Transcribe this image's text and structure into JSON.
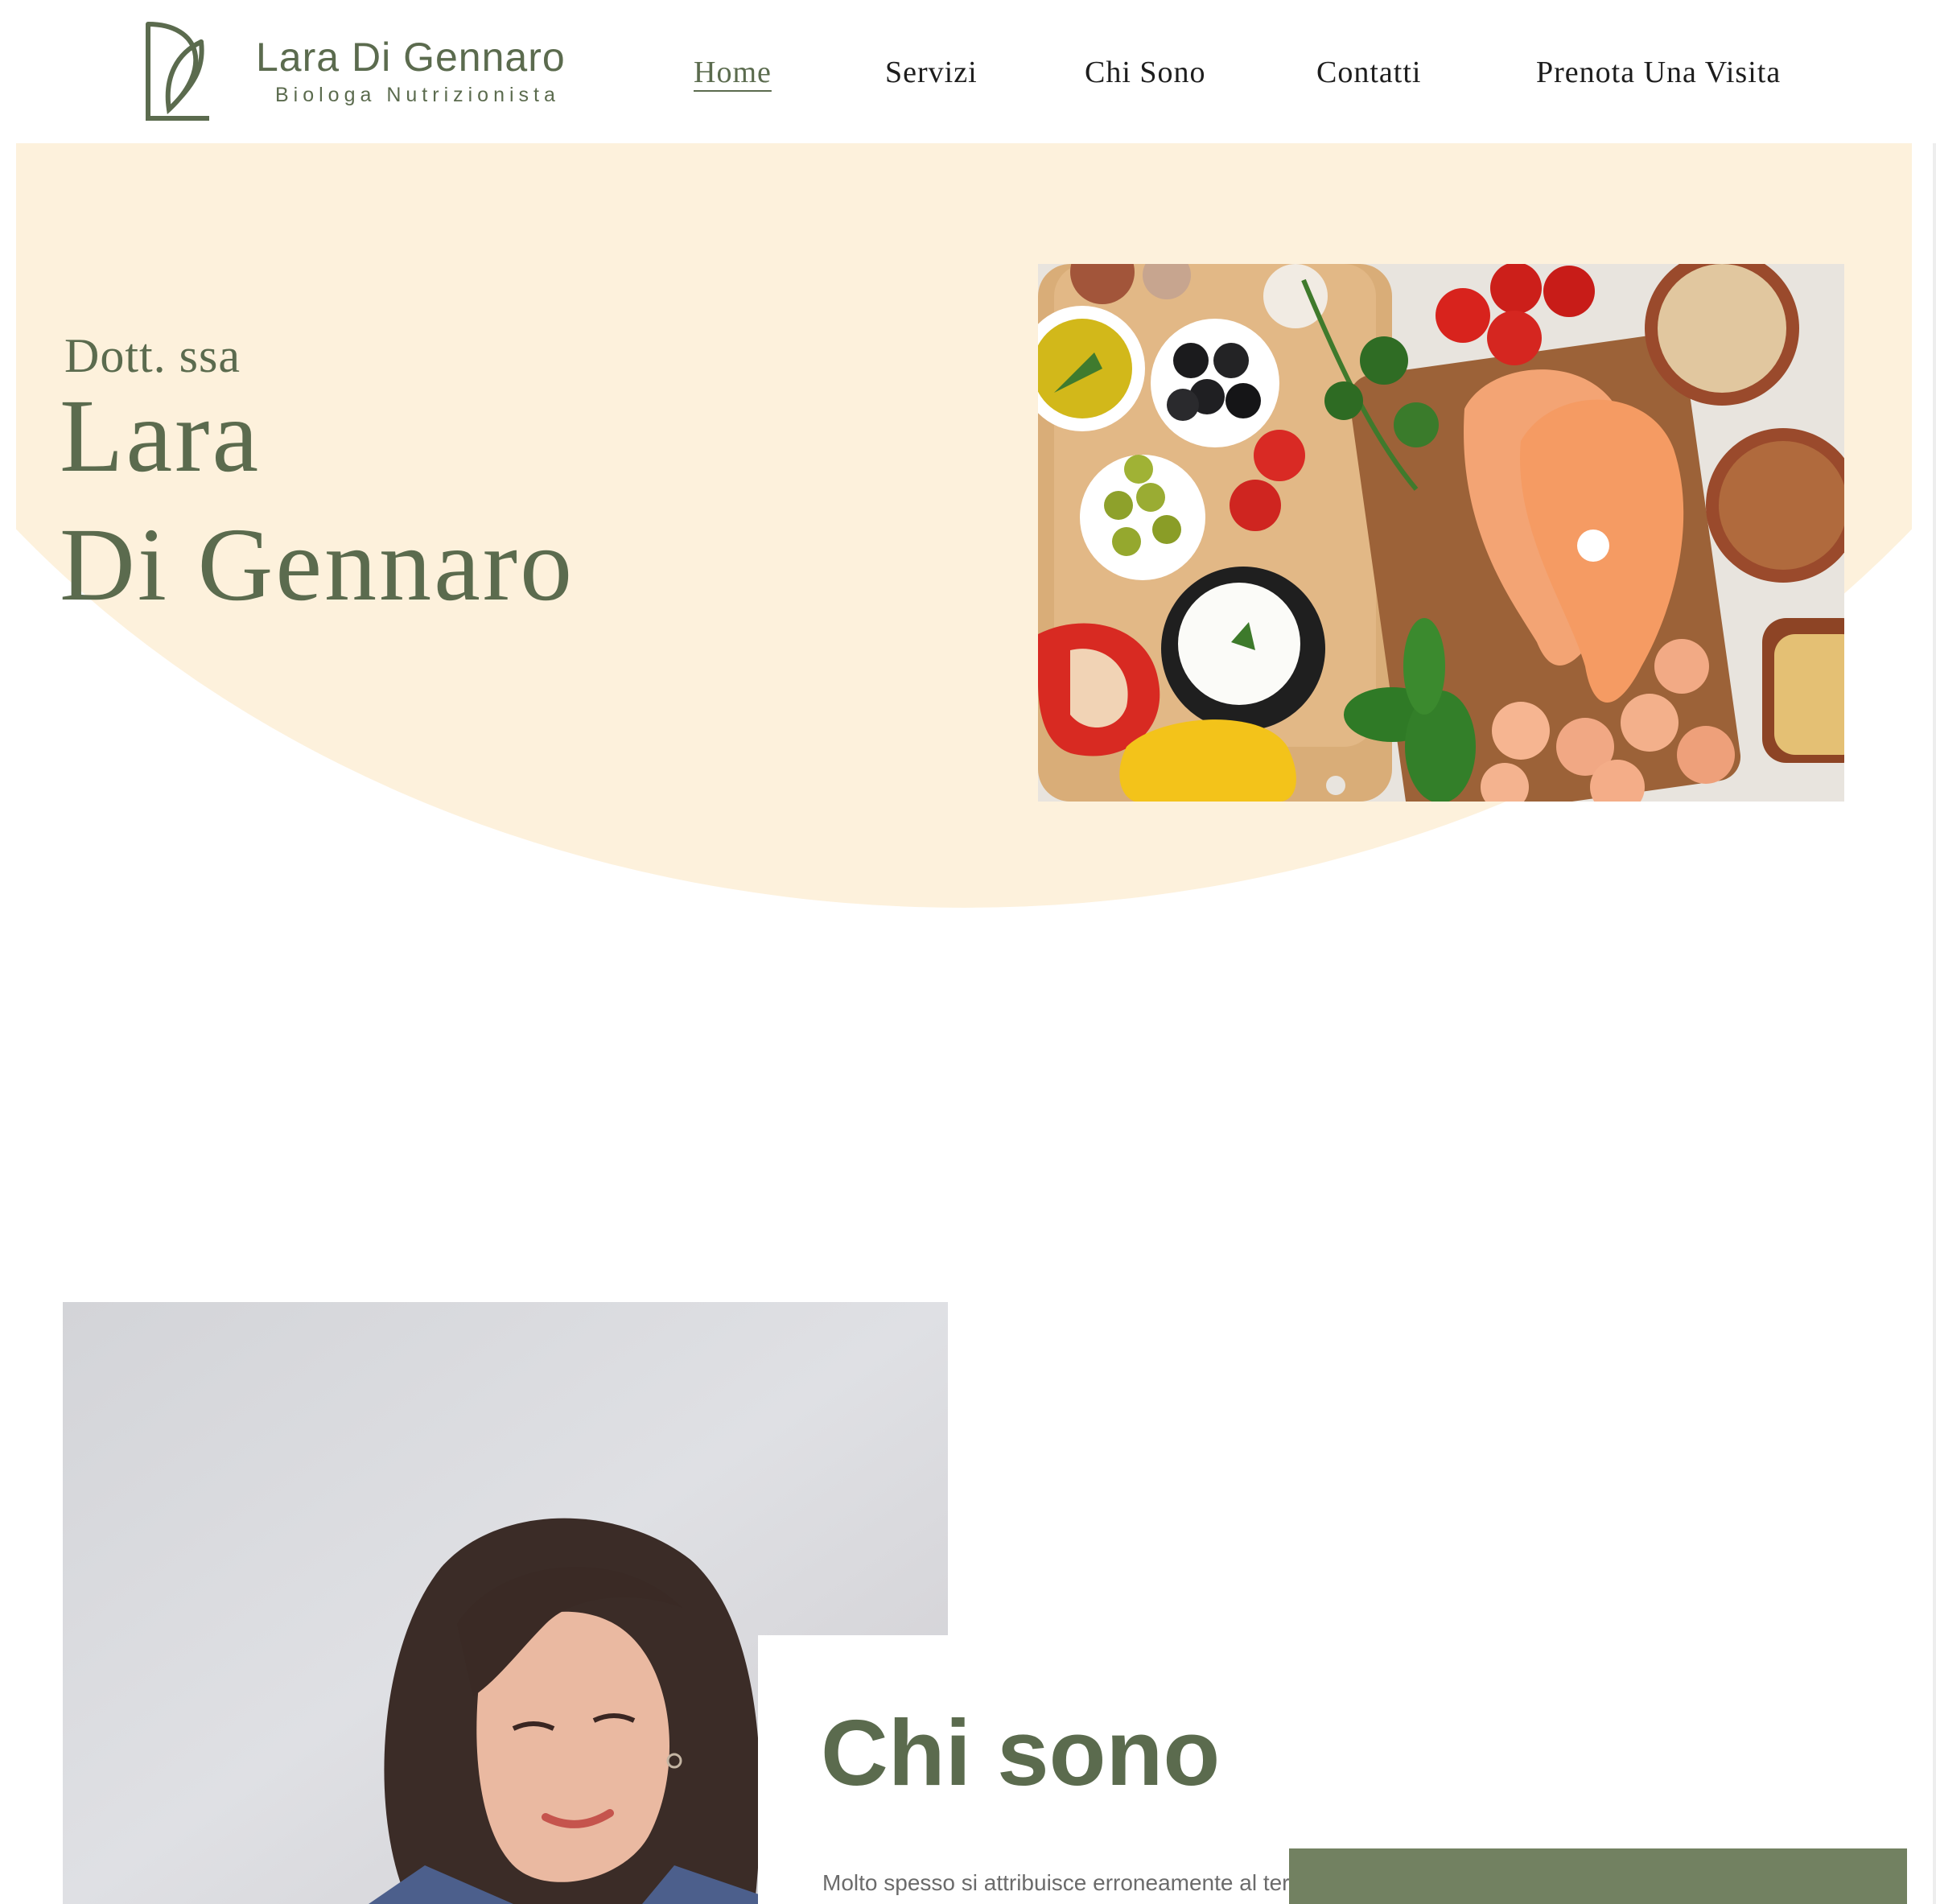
{
  "brand": {
    "name": "Lara Di Gennaro",
    "subtitle": "Biologa Nutrizionista",
    "color": "#5b6b4e"
  },
  "nav": {
    "items": [
      {
        "label": "Home",
        "active": true
      },
      {
        "label": "Servizi",
        "active": false
      },
      {
        "label": "Chi Sono",
        "active": false
      },
      {
        "label": "Contatti",
        "active": false
      },
      {
        "label": "Prenota Una Visita",
        "active": false
      }
    ]
  },
  "hero": {
    "pre": "Dott. ssa",
    "name_line1": "Lara",
    "name_line2": "Di Gennaro",
    "background_color": "#fdf1dc"
  },
  "about": {
    "title": "Chi sono",
    "text": "Molto spesso si attribuisce erroneamente al termine",
    "accent_color": "#728161"
  }
}
